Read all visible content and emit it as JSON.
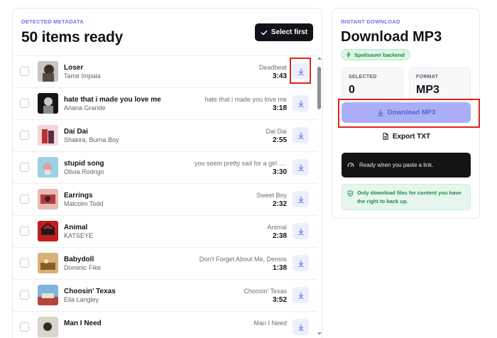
{
  "left": {
    "eyebrow": "DETECTED METADATA",
    "title": "50 items ready",
    "select_first_label": "Select first"
  },
  "rows": [
    {
      "track": "Loser",
      "artist": "Tame Impala",
      "album": "Deadbeat",
      "duration": "3:43",
      "thumb": "loser-cover"
    },
    {
      "track": "hate that i made you love me",
      "artist": "Ariana Grande",
      "album": "hate that i made you love me",
      "duration": "3:18",
      "thumb": "ariana-cover"
    },
    {
      "track": "Dai Dai",
      "artist": "Shakira, Burna Boy",
      "album": "Dai Dai",
      "duration": "2:55",
      "thumb": "daidai-cover"
    },
    {
      "track": "stupid song",
      "artist": "Olivia Rodrigo",
      "album": "you seem pretty sad for a girl so in love",
      "duration": "3:30",
      "thumb": "olivia-cover"
    },
    {
      "track": "Earrings",
      "artist": "Malcolm Todd",
      "album": "Sweet Boy",
      "duration": "2:32",
      "thumb": "earrings-cover"
    },
    {
      "track": "Animal",
      "artist": "KATSEYE",
      "album": "Animal",
      "duration": "2:38",
      "thumb": "katseye-cover"
    },
    {
      "track": "Babydoll",
      "artist": "Dominic Fike",
      "album": "Don't Forget About Me, Demos",
      "duration": "1:38",
      "thumb": "babydoll-cover"
    },
    {
      "track": "Choosin' Texas",
      "artist": "Ella Langley",
      "album": "Choosin' Texas",
      "duration": "3:52",
      "thumb": "texas-cover"
    },
    {
      "track": "Man I Need",
      "artist": "",
      "album": "Man I Need",
      "duration": "",
      "thumb": "maninneed-cover"
    }
  ],
  "right": {
    "eyebrow": "INSTANT DOWNLOAD",
    "title": "Download MP3",
    "badge": "Spotisaver backend",
    "selected_label": "SELECTED",
    "selected_value": "0",
    "format_label": "FORMAT",
    "format_value": "MP3",
    "download_label": "Download MP3",
    "export_label": "Export TXT",
    "status_text": "Ready when you paste a link.",
    "notice": "Only download files for content you have the right to back up."
  },
  "colors": {
    "accent": "#6b72e8",
    "button_disabled": "#a9aef6",
    "highlight": "#e0241b",
    "success": "#1f8a4c"
  }
}
